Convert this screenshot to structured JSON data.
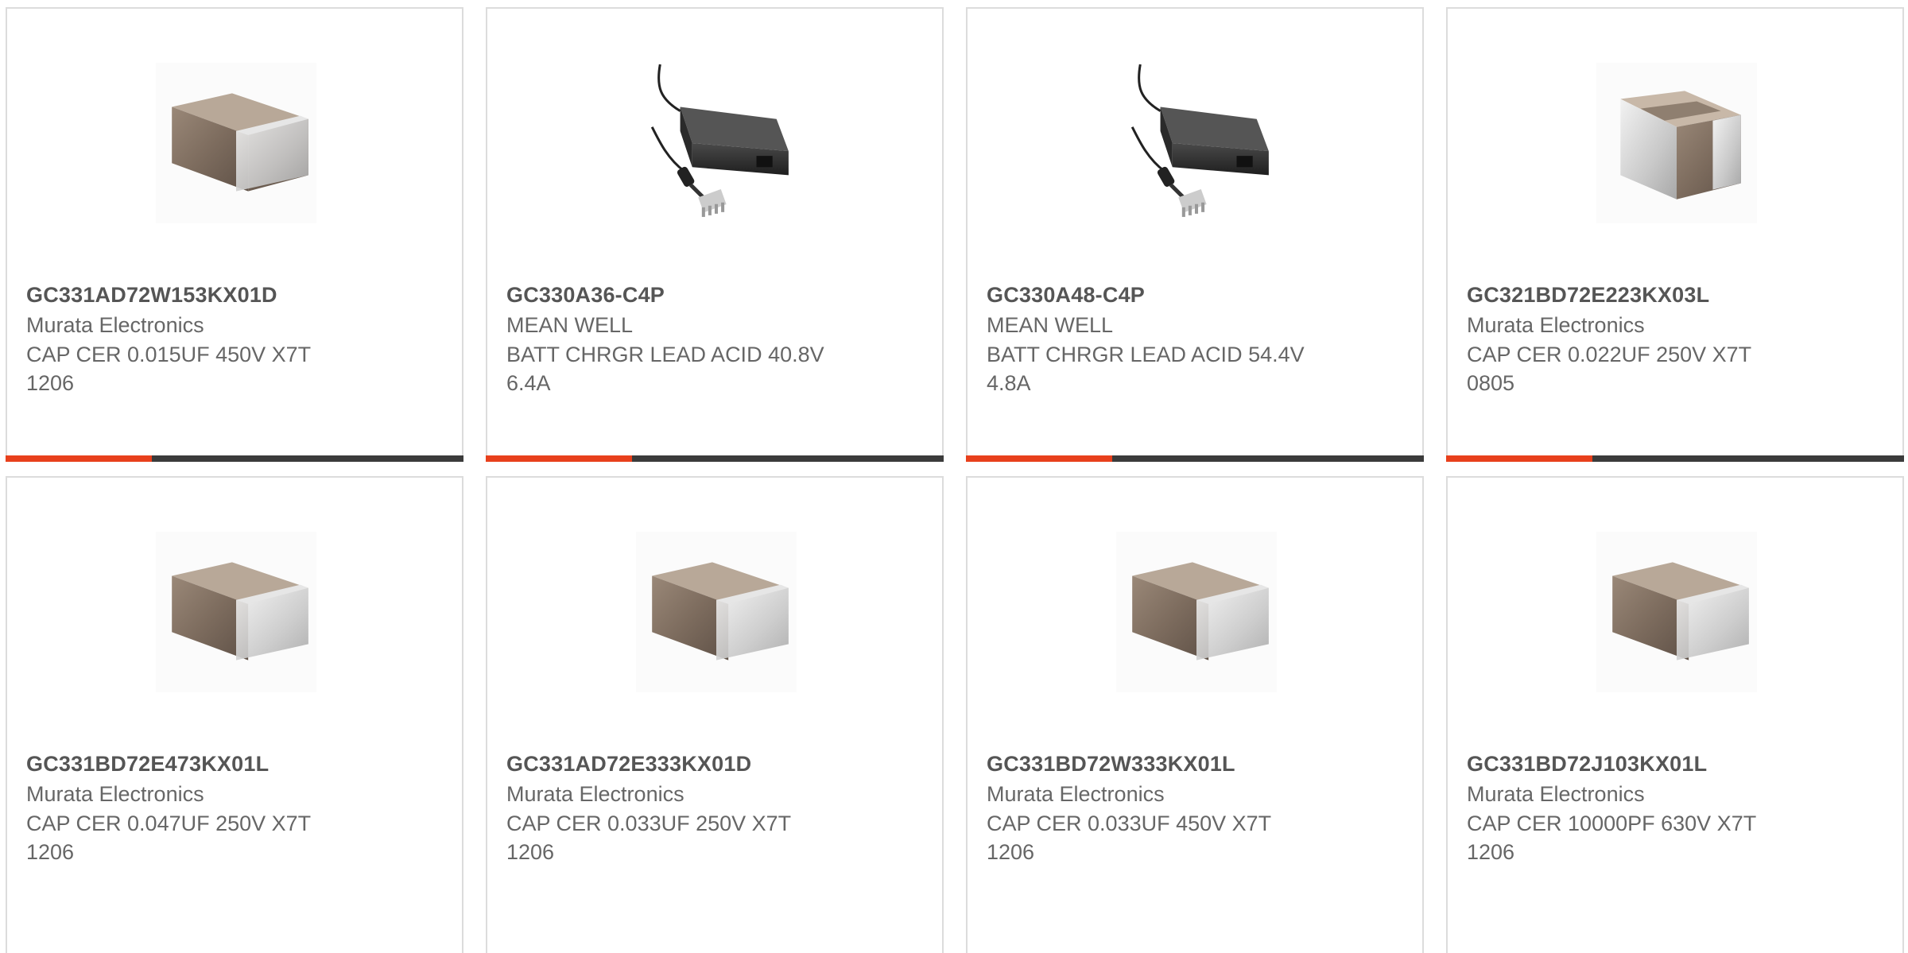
{
  "colors": {
    "accent": "#e8401c",
    "bar": "#3b3b3b",
    "border": "#dcdcdc",
    "text": "#666666"
  },
  "products": [
    {
      "part": "GC331AD72W153KX01D",
      "manufacturer": "Murata Electronics",
      "desc1": "CAP CER 0.015UF 450V X7T",
      "desc2": "1206",
      "image": "ceramic-capacitor-icon"
    },
    {
      "part": "GC330A36-C4P",
      "manufacturer": "MEAN WELL",
      "desc1": "BATT CHRGR LEAD ACID 40.8V",
      "desc2": "6.4A",
      "image": "battery-charger-icon"
    },
    {
      "part": "GC330A48-C4P",
      "manufacturer": "MEAN WELL",
      "desc1": "BATT CHRGR LEAD ACID 54.4V",
      "desc2": "4.8A",
      "image": "battery-charger-icon"
    },
    {
      "part": "GC321BD72E223KX03L",
      "manufacturer": "Murata Electronics",
      "desc1": "CAP CER 0.022UF 250V X7T",
      "desc2": "0805",
      "image": "ceramic-capacitor-icon"
    },
    {
      "part": "GC331BD72E473KX01L",
      "manufacturer": "Murata Electronics",
      "desc1": "CAP CER 0.047UF 250V X7T",
      "desc2": "1206",
      "image": "ceramic-capacitor-icon"
    },
    {
      "part": "GC331AD72E333KX01D",
      "manufacturer": "Murata Electronics",
      "desc1": "CAP CER 0.033UF 250V X7T",
      "desc2": "1206",
      "image": "ceramic-capacitor-icon"
    },
    {
      "part": "GC331BD72W333KX01L",
      "manufacturer": "Murata Electronics",
      "desc1": "CAP CER 0.033UF 450V X7T",
      "desc2": "1206",
      "image": "ceramic-capacitor-icon"
    },
    {
      "part": "GC331BD72J103KX01L",
      "manufacturer": "Murata Electronics",
      "desc1": "CAP CER 10000PF 630V X7T",
      "desc2": "1206",
      "image": "ceramic-capacitor-icon"
    }
  ]
}
